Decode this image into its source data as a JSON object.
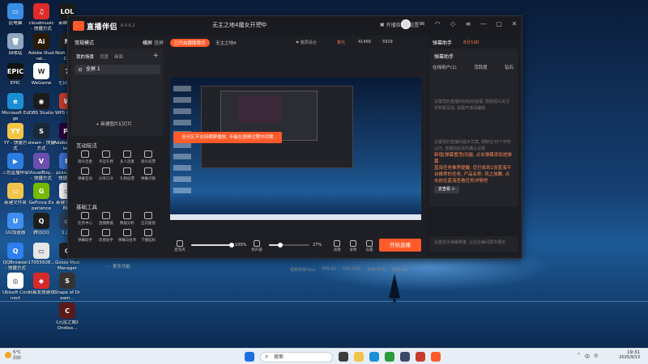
{
  "desktop": {
    "icons": [
      {
        "label": "此电脑",
        "color": "#3a8ee6",
        "glyph": "▭"
      },
      {
        "label": "回收站",
        "color": "#8fa6c2",
        "glyph": "🗑"
      },
      {
        "label": "EPIC",
        "color": "#111111",
        "glyph": "EPIC",
        "sublabel": "EpicGame..."
      },
      {
        "label": "Microsoft Edge",
        "color": "#1b8fd6",
        "glyph": "e"
      },
      {
        "label": "YY - 快捷方式",
        "color": "#f6c445",
        "glyph": "YY"
      },
      {
        "label": "三色直播伴侣 ...",
        "color": "#2c7de0",
        "glyph": "▶"
      },
      {
        "label": "新建文件夹",
        "color": "#f1c44c",
        "glyph": "▭"
      },
      {
        "label": "UU加速器",
        "color": "#3f8ff0",
        "glyph": "U"
      },
      {
        "label": "QQBrowser - 快捷方式",
        "color": "#2f7ff2",
        "glyph": "Q"
      },
      {
        "label": "Ubisoft Connect",
        "color": "#ffffff",
        "glyph": "◎"
      },
      {
        "label": "cloudmusic - 快捷方式",
        "color": "#e12b2b",
        "glyph": "♫"
      },
      {
        "label": "Adobe Illustrat...",
        "color": "#2a1a00",
        "glyph": "Ai"
      },
      {
        "label": "WeGame",
        "color": "#ffffff",
        "glyph": "W"
      },
      {
        "label": "OBS Studio",
        "color": "#1b1b1b",
        "glyph": "◉"
      },
      {
        "label": "steam - 快捷方式",
        "color": "#1b2838",
        "glyph": "S"
      },
      {
        "label": "VisualBoy... - 快捷方式",
        "color": "#6a4fb0",
        "glyph": "V"
      },
      {
        "label": "GeForce Experience",
        "color": "#76b900",
        "glyph": "G"
      },
      {
        "label": "腾讯QQ",
        "color": "#1e1e1e",
        "glyph": "Q"
      },
      {
        "label": "17055608...",
        "color": "#e6e6e6",
        "glyph": "▭"
      },
      {
        "label": "网易发烧游戏",
        "color": "#d62a2a",
        "glyph": "◆"
      },
      {
        "label": "英雄联盟",
        "color": "#1a1a1a",
        "glyph": "LOL"
      },
      {
        "label": "Nioh 2 The C...",
        "color": "#222222",
        "glyph": "N"
      },
      {
        "label": "七日世界",
        "color": "#2b2b2b",
        "glyph": "7"
      },
      {
        "label": "WPS Office",
        "color": "#c63d2b",
        "glyph": "W"
      },
      {
        "label": "Adobe Premie...",
        "color": "#2a003a",
        "glyph": "Pr"
      },
      {
        "label": "pcsx2-qt - 快捷方式",
        "color": "#3b6fd1",
        "glyph": "P"
      },
      {
        "label": "新建文本文档...",
        "color": "#f2f2f2",
        "glyph": "▭"
      },
      {
        "label": "1.jpg",
        "color": "#2a3d5a",
        "glyph": "▭"
      },
      {
        "label": "Gcoss Mod Manager",
        "color": "#222222",
        "glyph": "G"
      },
      {
        "label": "Shape of Dream...",
        "color": "#333333",
        "glyph": "S"
      },
      {
        "label": "《沉没之城》Ondiso...",
        "color": "#5a1a1a",
        "glyph": "C"
      }
    ]
  },
  "app": {
    "name": "直播伴侣",
    "version": "8.4.6.2",
    "stream_title": "无主之地4魔女开荒中",
    "edit_icon": "edit-icon",
    "actions": {
      "guide": "开播指南",
      "settings": "设置"
    },
    "left": {
      "mode": "常规模式",
      "mode_switch": "横屏",
      "mode_switch2": "竖屏",
      "scene_tabs": [
        "我的场景",
        "背景",
        "画面"
      ],
      "scene_item": "全屏 1",
      "add_scene": "+ 新建图片幻灯片",
      "interactive_title": "互动玩法",
      "interactive_tools": [
        "观众连麦",
        "幸运礼物",
        "多人连麦",
        "观众投票",
        "弹幕互动",
        "分享口令",
        "礼物投票",
        "弹幕点歌"
      ],
      "basic_title": "基础工具",
      "basic_tools": [
        "任务中心",
        "直播数据",
        "数据分析",
        "正向复盘",
        "弹幕助手",
        "房管助手",
        "弹幕白名单",
        "下播挂机"
      ],
      "more": "更多功能"
    },
    "center": {
      "live_badge": "已开启跟随裁切",
      "stream_name": "无主之地4",
      "rt_a": "❤ 整屏适合",
      "rt_b": "复元",
      "rt_c": "41468",
      "rt_d": "5929",
      "rt_e": "",
      "alert": "全分区不支持横屏播放, 不能在竖屏过程中切换",
      "controls": {
        "mic_label": "麦克风",
        "mic_pct": "100%",
        "speaker_label": "扬声器",
        "speaker_pct": "27%",
        "filter_label": "滤镜",
        "record_label": "录像",
        "setting_label": "设置",
        "start_btn": "开始直播"
      },
      "status": [
        "视频帧率(fps)",
        "FPS:60",
        "CPU:25%",
        "内存:47%",
        "帧率:60"
      ]
    },
    "right": {
      "head": "弹幕助手",
      "head2": "8分100",
      "box1_title": "弹幕助手",
      "tabs": [
        "在线用户(1)",
        "活跃度",
        "钻石"
      ],
      "box2_lines": [
        "设置您的直播的初始欢迎语, 鼓励观众关注并积极互动, 如需开通请编辑",
        "设置您的直播间提示文案, 限制在30个字符以内, 直播前后请先确认设置"
      ],
      "notice1": "新增[弹幕置顶]功能, 点击弹幕添加进弹幕",
      "notice2": "蓝海任务推荐提醒: 您已收到1张蓝海平台推荐的任务, 产品名称: 风之旅舞, 点击前往蓝海查看任务详情吧",
      "go_btn": "去查看 >",
      "box3_text": "设置显示弹幕数量, 以后在每间屏中展示"
    }
  },
  "taskbar": {
    "weather_temp": "5°C",
    "weather_desc": "阴转",
    "search": "搜索",
    "clock_time": "19:31",
    "clock_date": "2025/9/13",
    "tray": [
      "⌃",
      "中",
      "◎"
    ]
  }
}
